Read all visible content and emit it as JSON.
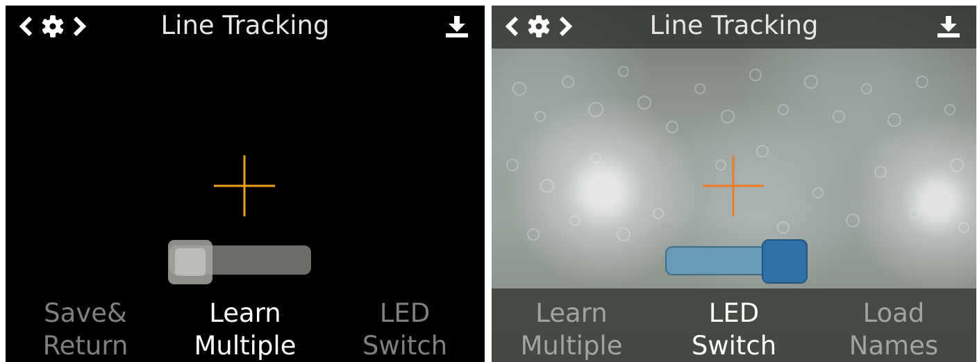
{
  "screens": [
    {
      "title": "Line Tracking",
      "crosshair_color": "#e7a21f",
      "slider_state": "off",
      "buttons": [
        "Save&\nReturn",
        "Learn\nMultiple",
        "LED\nSwitch"
      ],
      "active_button_index": 1
    },
    {
      "title": "Line Tracking",
      "crosshair_color": "#ee7a24",
      "slider_state": "on",
      "buttons": [
        "Learn\nMultiple",
        "LED\nSwitch",
        "Load\nNames"
      ],
      "active_button_index": 1
    }
  ],
  "icons": {
    "prev": "chevron-left-icon",
    "settings": "gear-icon",
    "next": "chevron-right-icon",
    "save": "download-icon"
  },
  "colors": {
    "slider_on_track": "#6a9bb6",
    "slider_on_knob": "#2f72a8",
    "slider_off_track": "#6c6c69",
    "slider_off_knob": "#a6a8a1"
  }
}
